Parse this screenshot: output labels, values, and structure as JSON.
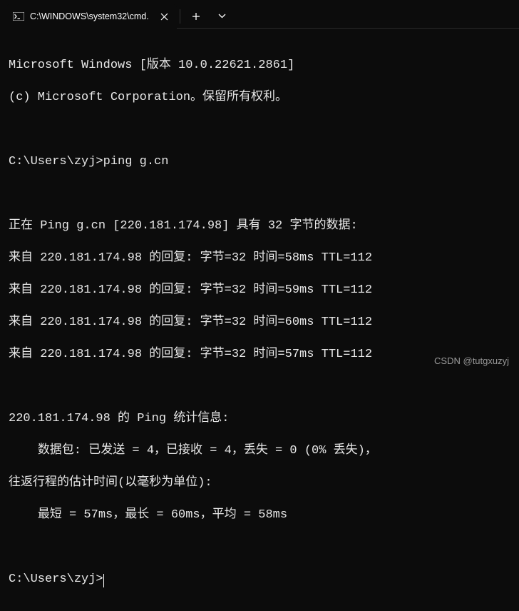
{
  "titlebar": {
    "tab_title": "C:\\WINDOWS\\system32\\cmd."
  },
  "terminal": {
    "header1": "Microsoft Windows [版本 10.0.22621.2861]",
    "header2": "(c) Microsoft Corporation。保留所有权利。",
    "prompt1": "C:\\Users\\zyj>ping g.cn",
    "ping_header": "正在 Ping g.cn [220.181.174.98] 具有 32 字节的数据:",
    "replies": [
      "来自 220.181.174.98 的回复: 字节=32 时间=58ms TTL=112",
      "来自 220.181.174.98 的回复: 字节=32 时间=59ms TTL=112",
      "来自 220.181.174.98 的回复: 字节=32 时间=60ms TTL=112",
      "来自 220.181.174.98 的回复: 字节=32 时间=57ms TTL=112"
    ],
    "stats_header": "220.181.174.98 的 Ping 统计信息:",
    "stats_packets": "    数据包: 已发送 = 4，已接收 = 4，丢失 = 0 (0% 丢失)，",
    "stats_rtt_header": "往返行程的估计时间(以毫秒为单位):",
    "stats_rtt": "    最短 = 57ms，最长 = 60ms，平均 = 58ms",
    "prompt2": "C:\\Users\\zyj>"
  },
  "watermark": "CSDN @tutgxuzyj"
}
